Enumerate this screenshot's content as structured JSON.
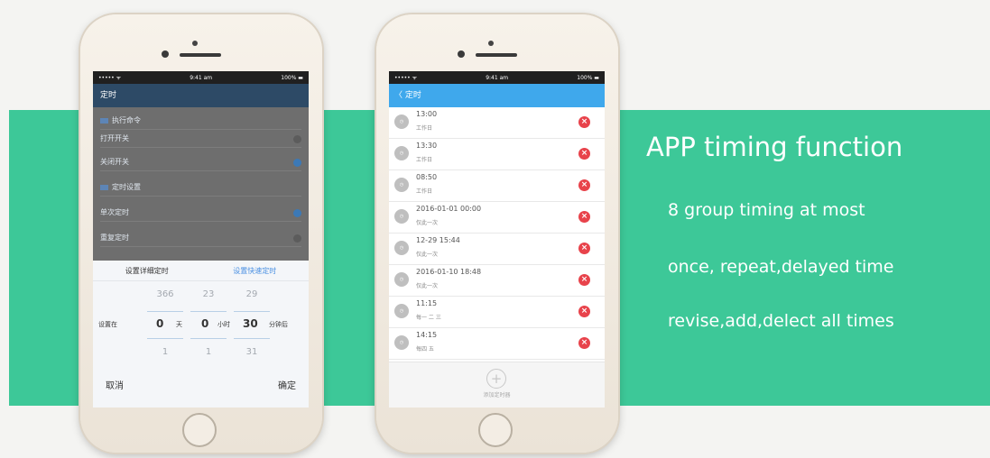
{
  "banner": {
    "title": "APP timing function",
    "features": [
      "8 group timing at most",
      "once, repeat,delayed time",
      "revise,add,delect all times"
    ]
  },
  "colors": {
    "band": "#3dc898",
    "left_header": "#2d4a66",
    "right_header": "#3fa8ec",
    "delete": "#e8434b"
  },
  "phone_left": {
    "status": {
      "carrier": "••••• ᯤ",
      "time": "9:41 am",
      "battery": "100% ▬"
    },
    "header_title": "定时",
    "rows": [
      {
        "label": "执行命令",
        "icon": "list-icon"
      },
      {
        "label": "打开开关"
      },
      {
        "label": "关闭开关"
      },
      {
        "label": "定时设置",
        "icon": "clock-icon"
      },
      {
        "label": "单次定时"
      },
      {
        "label": "重复定时"
      }
    ],
    "picker": {
      "tab_left": "设置详细定时",
      "tab_right": "设置快速定时",
      "above": [
        "366",
        "23",
        "29"
      ],
      "prefix": "设置在",
      "values": [
        "0",
        "0",
        "30"
      ],
      "units": [
        "天",
        "小时",
        "分钟后"
      ],
      "below": [
        "1",
        "1",
        "31"
      ],
      "cancel": "取消",
      "confirm": "确定"
    }
  },
  "phone_right": {
    "status": {
      "carrier": "••••• ᯤ",
      "time": "9:41 am",
      "battery": "100% ▬"
    },
    "header_title": "〈 定时",
    "items": [
      {
        "time": "13:00",
        "sub": "工作日"
      },
      {
        "time": "13:30",
        "sub": "工作日"
      },
      {
        "time": "08:50",
        "sub": "工作日"
      },
      {
        "time": "2016-01-01 00:00",
        "sub": "仅此一次"
      },
      {
        "time": "12-29 15:44",
        "sub": "仅此一次"
      },
      {
        "time": "2016-01-10 18:48",
        "sub": "仅此一次"
      },
      {
        "time": "11:15",
        "sub": "每一 二 三"
      },
      {
        "time": "14:15",
        "sub": "每四 五"
      }
    ],
    "add_label": "添加定时器"
  }
}
